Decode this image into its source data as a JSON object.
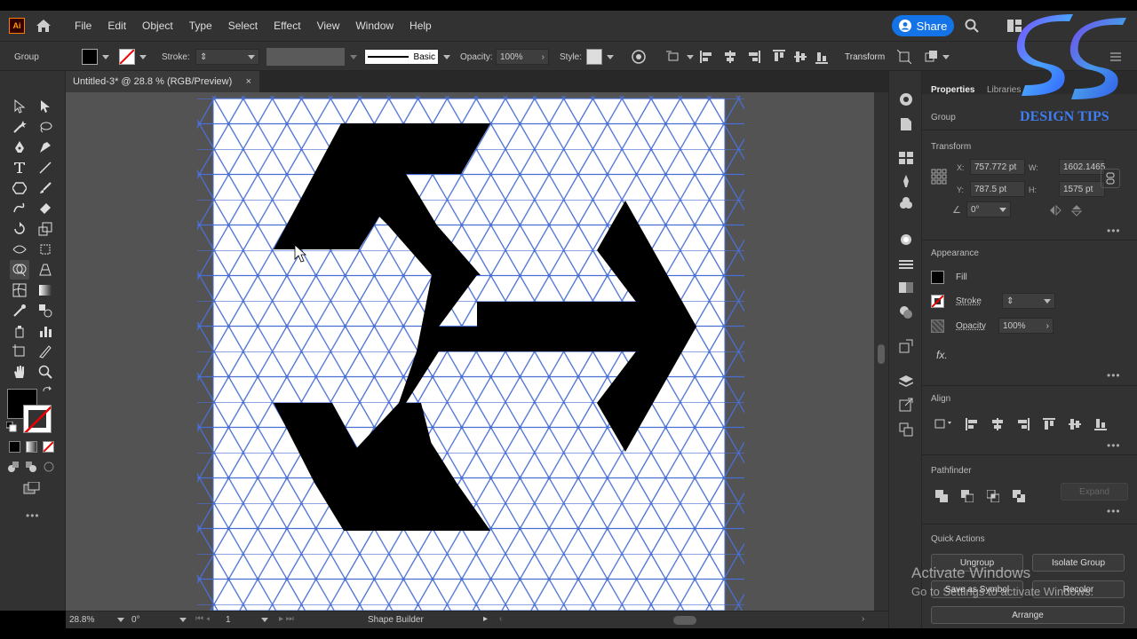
{
  "menubar": {
    "app_logo": "Ai",
    "home_icon": "home-icon",
    "items": [
      "File",
      "Edit",
      "Object",
      "Type",
      "Select",
      "Effect",
      "View",
      "Window",
      "Help"
    ],
    "share_label": "Share"
  },
  "control_bar": {
    "selection_label": "Group",
    "stroke_label": "Stroke:",
    "brush_label": "Basic",
    "opacity_label": "Opacity:",
    "opacity_value": "100%",
    "style_label": "Style:",
    "transform_label": "Transform"
  },
  "document": {
    "tab_title": "Untitled-3* @ 28.8 % (RGB/Preview)",
    "close_glyph": "×"
  },
  "status_bar": {
    "zoom": "28.8%",
    "rotation": "0°",
    "artboard": "1",
    "tool": "Shape Builder"
  },
  "panel": {
    "tabs": [
      "Properties",
      "Libraries"
    ],
    "selection_type": "Group",
    "transform": {
      "title": "Transform",
      "x_label": "X:",
      "x_value": "757.772 pt",
      "y_label": "Y:",
      "y_value": "787.5 pt",
      "w_label": "W:",
      "w_value": "1602.1465",
      "h_label": "H:",
      "h_value": "1575 pt",
      "angle_value": "0°"
    },
    "appearance": {
      "title": "Appearance",
      "fill_label": "Fill",
      "stroke_label": "Stroke",
      "opacity_label": "Opacity",
      "opacity_value": "100%",
      "fx_label": "fx."
    },
    "align": {
      "title": "Align"
    },
    "pathfinder": {
      "title": "Pathfinder",
      "expand_label": "Expand"
    },
    "quick_actions": {
      "title": "Quick Actions",
      "ungroup": "Ungroup",
      "isolate": "Isolate Group",
      "save_symbol": "Save as Symbol",
      "recolor": "Recolor",
      "arrange": "Arrange"
    }
  },
  "overlay": {
    "watermark_line1": "Activate Windows",
    "watermark_line2": "Go to Settings to activate Windows.",
    "brand_text": "DESIGN TIPS"
  },
  "colors": {
    "accent": "#1473e6",
    "grid_line": "#4a6fd4",
    "artwork_fill": "#000000",
    "artboard": "#ffffff",
    "workspace": "#535353",
    "panel_bg": "#323232"
  }
}
